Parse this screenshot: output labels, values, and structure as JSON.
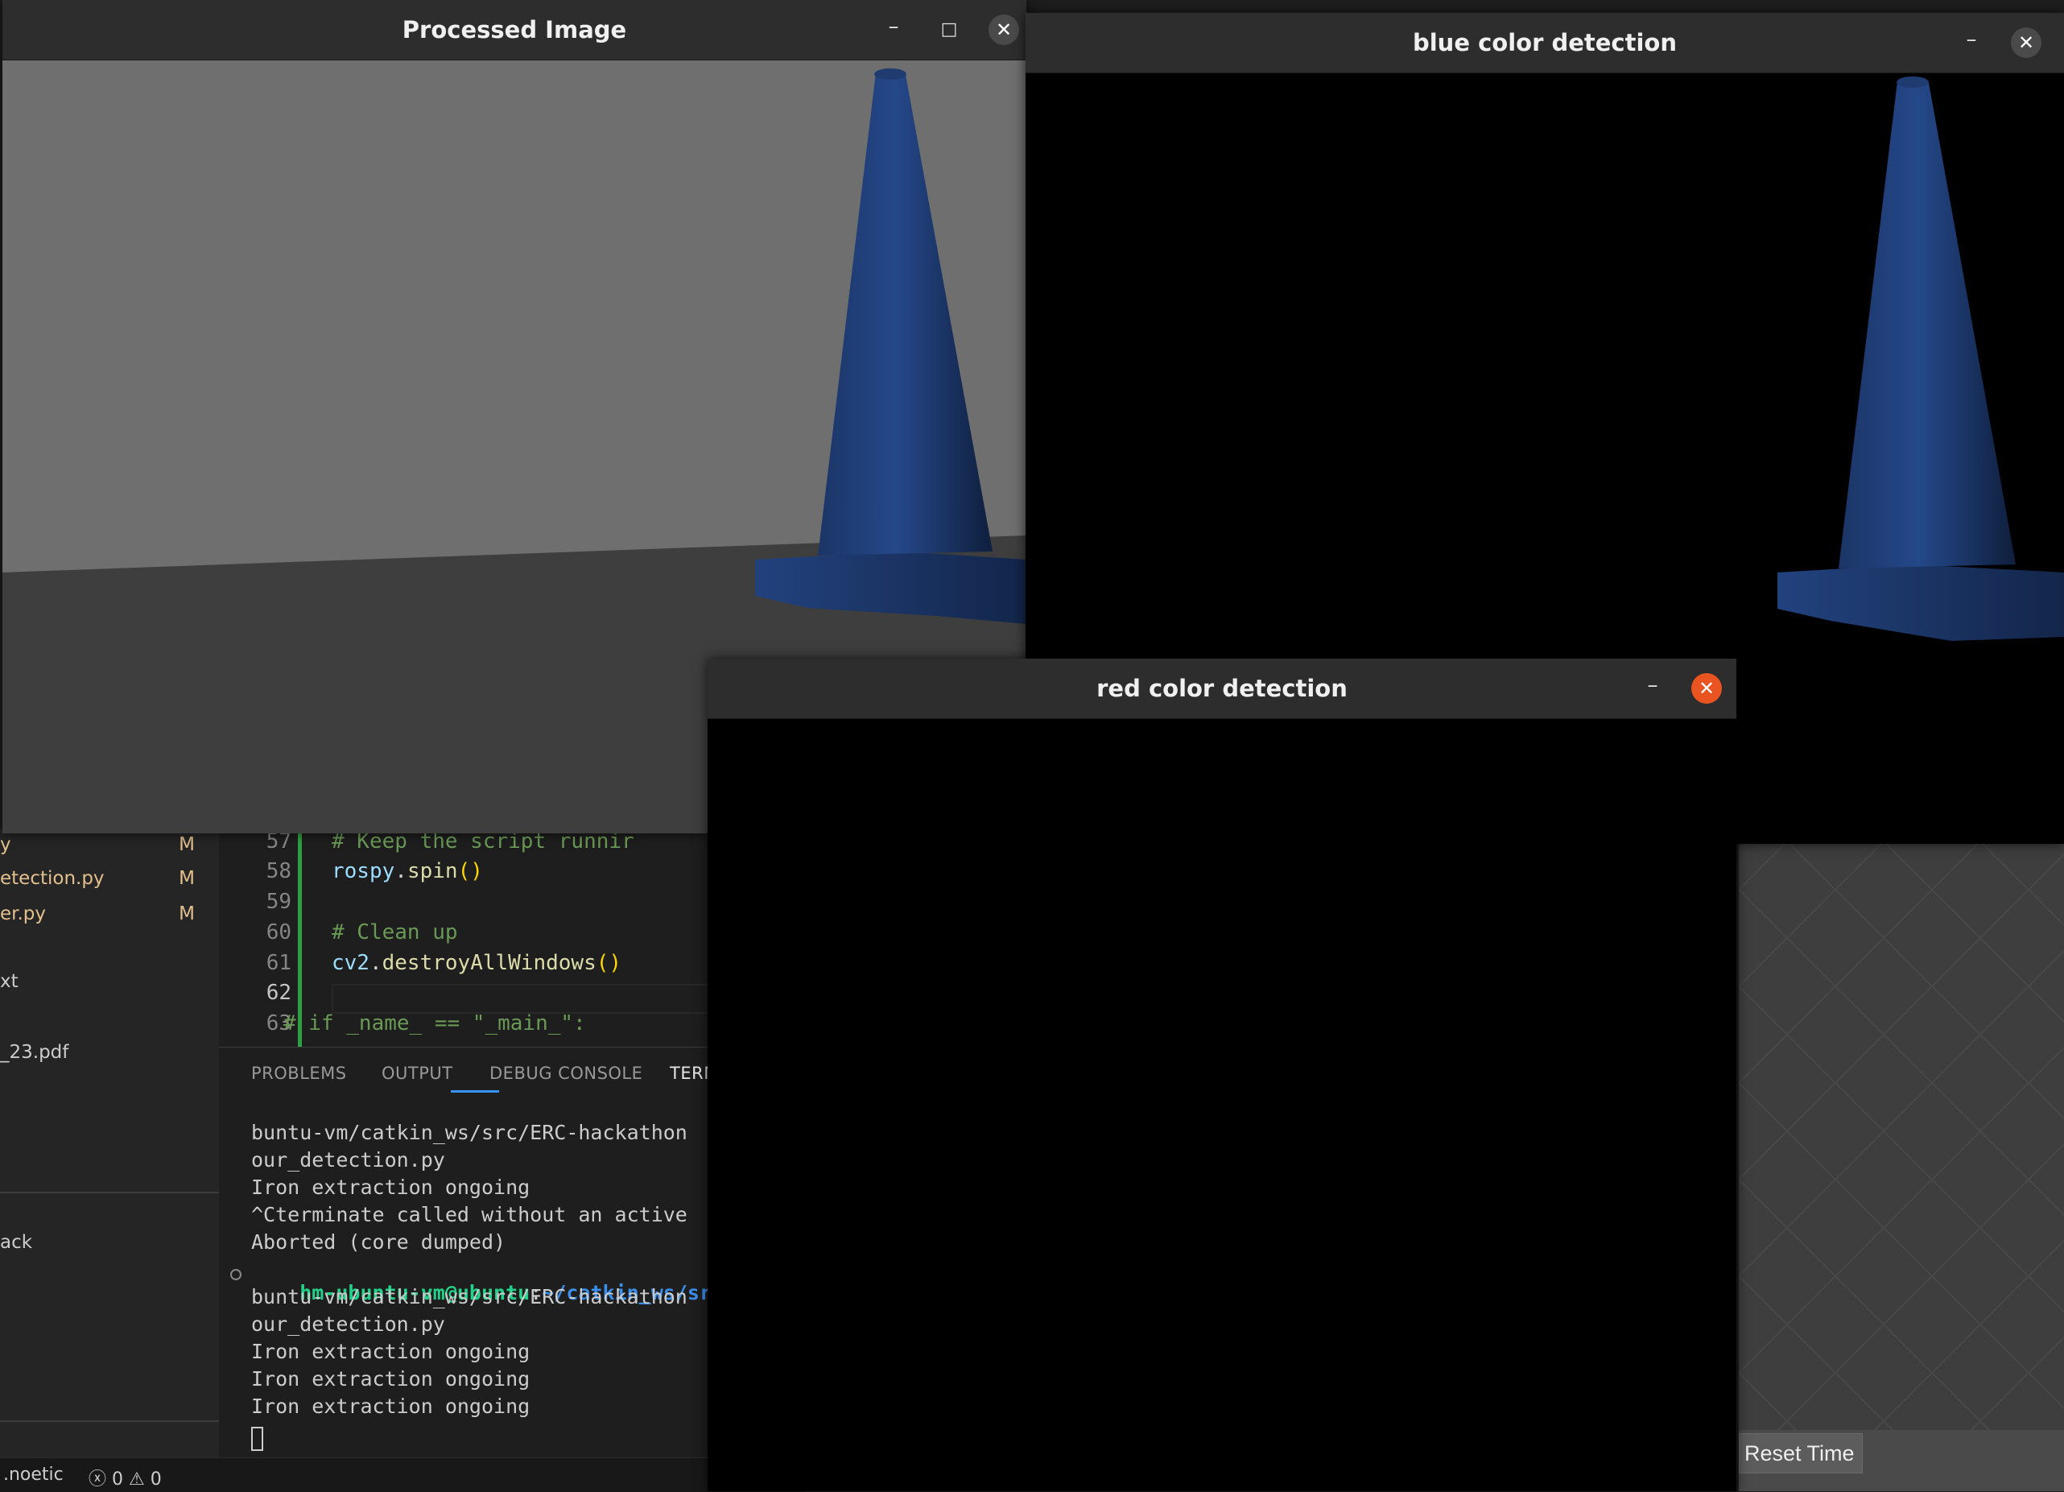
{
  "windows": {
    "processed": {
      "title": "Processed Image",
      "minimize": "–",
      "maximize": "□",
      "close": "✕"
    },
    "blue": {
      "title": "blue color detection",
      "minimize": "–",
      "close": "✕"
    },
    "red": {
      "title": "red color detection",
      "minimize": "–",
      "close": "✕"
    }
  },
  "explorer": {
    "files": [
      {
        "name": "y",
        "status": "M"
      },
      {
        "name": "etection.py",
        "status": "M"
      },
      {
        "name": "er.py",
        "status": "M"
      }
    ],
    "others": [
      "xt",
      "_23.pdf",
      "ack"
    ]
  },
  "editor": {
    "lines": [
      {
        "num": "57",
        "text": "# Keep the script runnir",
        "kind": "comment"
      },
      {
        "num": "58",
        "text": "rospy.spin()",
        "kind": "call"
      },
      {
        "num": "59",
        "text": "",
        "kind": "plain"
      },
      {
        "num": "60",
        "text": "# Clean up",
        "kind": "comment"
      },
      {
        "num": "61",
        "text": "cv2.destroyAllWindows()",
        "kind": "call"
      },
      {
        "num": "62",
        "text": "",
        "kind": "plain"
      },
      {
        "num": "63",
        "text": "# if _name_ == \"_main_\":",
        "kind": "comment"
      }
    ]
  },
  "panel": {
    "tabs": [
      "PROBLEMS",
      "OUTPUT",
      "DEBUG CONSOLE",
      "TERM"
    ],
    "terminal": [
      "buntu-vm/catkin_ws/src/ERC-hackathon",
      "our_detection.py",
      "Iron extraction ongoing",
      "^Cterminate called without an active",
      "Aborted (core dumped)",
      "",
      "buntu-vm/catkin_ws/src/ERC-hackathon",
      "our_detection.py",
      "Iron extraction ongoing",
      "Iron extraction ongoing",
      "Iron extraction ongoing"
    ],
    "prompt": {
      "user": "hm-ubuntu-vm@ubuntu",
      "sep": ":",
      "path": "~/catkin_ws/src/"
    }
  },
  "statusbar": {
    "branch": ".noetic",
    "errors": "ⓧ 0 ⚠ 0"
  },
  "gazebo": {
    "reset_time": "Reset Time"
  },
  "colors": {
    "cone_blue": "#1c3a6e",
    "wall_gray": "#6f6f6f",
    "floor_gray": "#3e3e3e",
    "close_active": "#e95420"
  }
}
